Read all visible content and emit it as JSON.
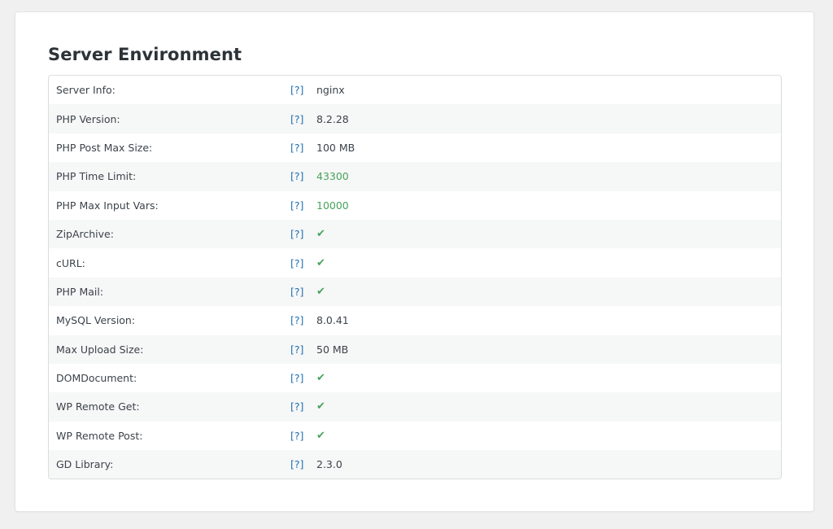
{
  "section": {
    "title": "Server Environment"
  },
  "colors": {
    "success": "#46a35a",
    "link": "#2271b1"
  },
  "rows": [
    {
      "label": "Server Info:",
      "help": "[?]",
      "value": "nginx",
      "status": "normal"
    },
    {
      "label": "PHP Version:",
      "help": "[?]",
      "value": "8.2.28",
      "status": "normal"
    },
    {
      "label": "PHP Post Max Size:",
      "help": "[?]",
      "value": "100 MB",
      "status": "normal"
    },
    {
      "label": "PHP Time Limit:",
      "help": "[?]",
      "value": "43300",
      "status": "good"
    },
    {
      "label": "PHP Max Input Vars:",
      "help": "[?]",
      "value": "10000",
      "status": "good"
    },
    {
      "label": "ZipArchive:",
      "help": "[?]",
      "value": "✔",
      "status": "check"
    },
    {
      "label": "cURL:",
      "help": "[?]",
      "value": "✔",
      "status": "check"
    },
    {
      "label": "PHP Mail:",
      "help": "[?]",
      "value": "✔",
      "status": "check"
    },
    {
      "label": "MySQL Version:",
      "help": "[?]",
      "value": "8.0.41",
      "status": "normal"
    },
    {
      "label": "Max Upload Size:",
      "help": "[?]",
      "value": "50 MB",
      "status": "normal"
    },
    {
      "label": "DOMDocument:",
      "help": "[?]",
      "value": "✔",
      "status": "check"
    },
    {
      "label": "WP Remote Get:",
      "help": "[?]",
      "value": "✔",
      "status": "check"
    },
    {
      "label": "WP Remote Post:",
      "help": "[?]",
      "value": "✔",
      "status": "check"
    },
    {
      "label": "GD Library:",
      "help": "[?]",
      "value": "2.3.0",
      "status": "normal"
    }
  ]
}
